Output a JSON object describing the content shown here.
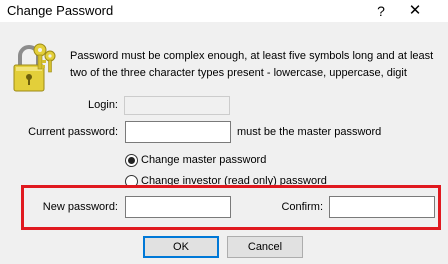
{
  "window": {
    "title": "Change Password",
    "help_glyph": "?",
    "close_glyph": "✕"
  },
  "description": "Password must be complex enough, at least five symbols long and at least two of the three character types present - lowercase, uppercase, digit",
  "fields": {
    "login_label": "Login:",
    "login_value": "",
    "current_password_label": "Current password:",
    "current_password_value": "",
    "current_password_hint": "must be the master password",
    "new_password_label": "New password:",
    "new_password_value": "",
    "confirm_label": "Confirm:",
    "confirm_value": ""
  },
  "options": {
    "change_master": "Change master password",
    "change_investor": "Change investor (read only) password",
    "selected": "change_master"
  },
  "buttons": {
    "ok": "OK",
    "cancel": "Cancel"
  },
  "colors": {
    "highlight": "#e0191f",
    "key_gold": "#e3cf3a",
    "default_button_border": "#0078d7"
  },
  "icons": {
    "lock": "lock-with-keys-icon"
  }
}
